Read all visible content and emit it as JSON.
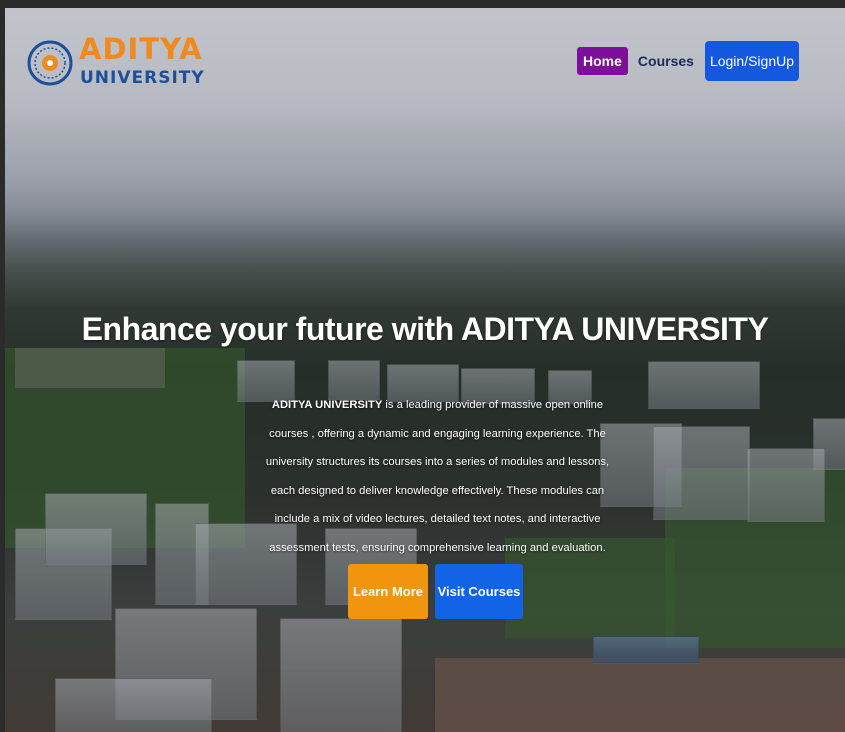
{
  "brand": {
    "name_line1": "ADITYA",
    "name_line2": "UNIVERSITY",
    "colors": {
      "orange": "#f08a1e",
      "blue": "#1d4f9a"
    }
  },
  "nav": {
    "home": "Home",
    "courses": "Courses",
    "login": "Login/SignUp",
    "colors": {
      "home_bg": "#7e0f9b",
      "login_bg": "#1558e0"
    }
  },
  "hero": {
    "title": "Enhance your future with ADITYA UNIVERSITY",
    "description_strong": "ADITYA UNIVERSITY",
    "description_rest": " is a leading provider of massive open online courses , offering a dynamic and engaging learning experience. The university structures its courses into a series of modules and lessons, each designed to deliver knowledge effectively. These modules can include a mix of video lectures, detailed text notes, and interactive assessment tests, ensuring comprehensive learning and evaluation."
  },
  "buttons": {
    "learn_more": "Learn More",
    "visit_courses": "Visit Courses",
    "colors": {
      "learn_more_bg": "#f2950e",
      "visit_courses_bg": "#1263e6"
    }
  }
}
